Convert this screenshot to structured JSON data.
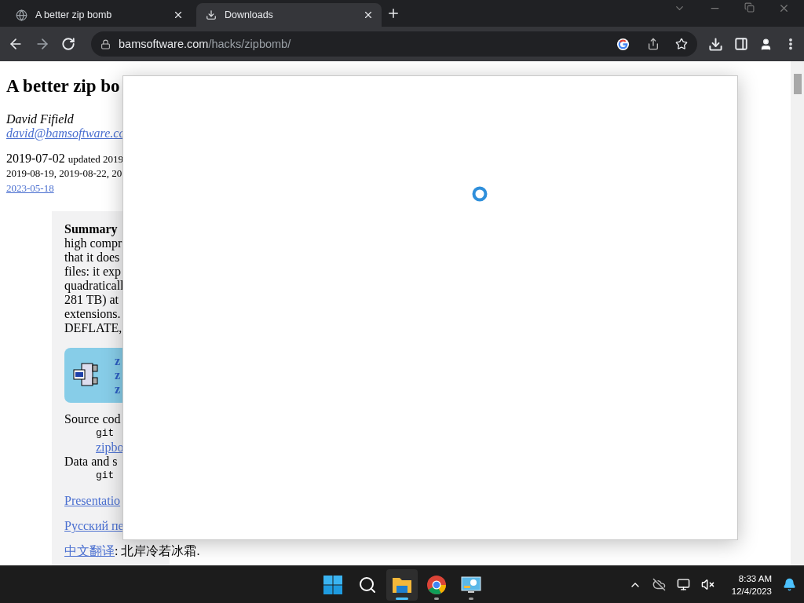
{
  "browser": {
    "tabs": [
      {
        "title": "A better zip bomb",
        "kind": "globe",
        "selected": false
      },
      {
        "title": "Downloads",
        "kind": "download",
        "selected": true
      }
    ],
    "url": {
      "domain": "bamsoftware.com",
      "path": "/hacks/zipbomb/"
    }
  },
  "page": {
    "title": "A better zip bo",
    "author": "David Fifield",
    "email": "david@bamsoftware.co",
    "date": "2019-07-02",
    "updated": "updated 2019",
    "dates_line": "2019-08-19, 2019-08-22, 20",
    "date_link": "2023-05-18",
    "summary": {
      "heading": "Summary",
      "lines": [
        "high compr",
        "that it does",
        "files: it exp",
        "quadraticall",
        "281 TB) at",
        "extensions.",
        "DEFLATE,"
      ]
    },
    "download_links": [
      "z",
      "z",
      "z"
    ],
    "source": {
      "label": "Source cod",
      "command": "git",
      "link": "zipbo",
      "data_label": "Data and s",
      "data_command": "git"
    },
    "links": [
      "Presentatio",
      "Русский пе"
    ],
    "chinese": {
      "link": "中文翻译",
      "text": ": 北岸冷若冰霜."
    }
  },
  "taskbar": {
    "apps": [
      {
        "kind": "start",
        "selected": false,
        "running": false
      },
      {
        "kind": "search",
        "selected": false,
        "running": false
      },
      {
        "kind": "explorer",
        "selected": true,
        "running": true
      },
      {
        "kind": "chrome",
        "selected": false,
        "running": true
      },
      {
        "kind": "monitor",
        "selected": false,
        "running": true
      }
    ],
    "time": "8:33 AM",
    "date": "12/4/2023"
  }
}
